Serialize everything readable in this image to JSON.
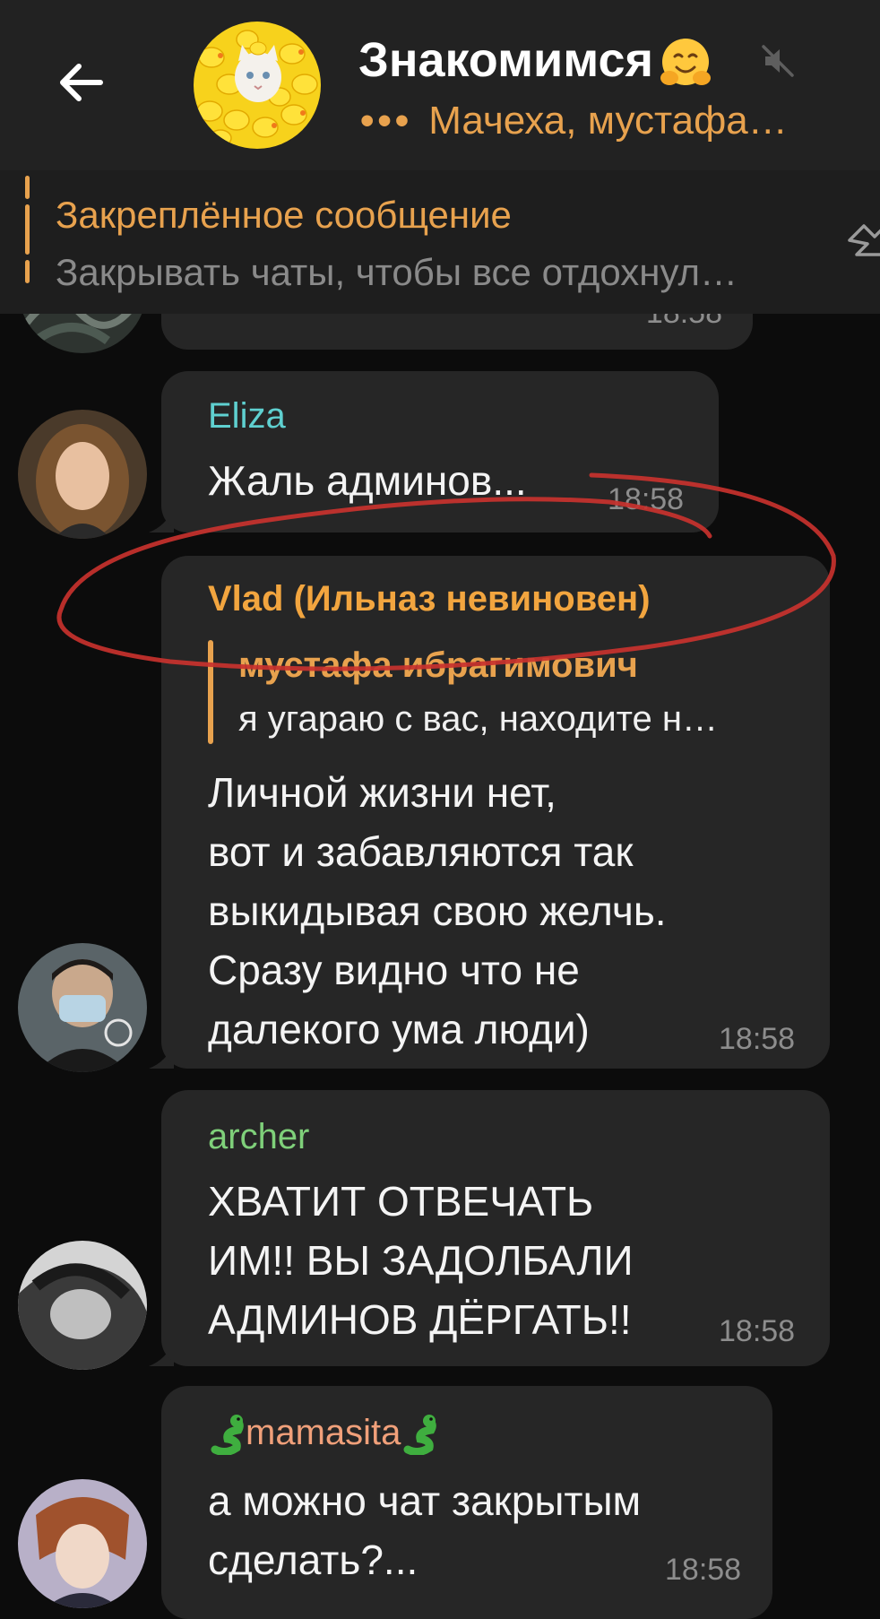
{
  "header": {
    "title": "Знакомимся",
    "status_dots": "•••",
    "status": "Мачеха, мустафа…",
    "colors": {
      "accent": "#e8a24e",
      "background": "#222222"
    }
  },
  "pinned": {
    "title": "Закреплённое сообщение",
    "text": "Закрывать чаты, чтобы все отдохнул…"
  },
  "messages": [
    {
      "time": "18:58"
    },
    {
      "sender": "Eliza",
      "sender_color": "#5fd0d0",
      "text": "Жаль админов...",
      "time": "18:58"
    },
    {
      "sender": "Vlad (Ильназ невиновен)",
      "sender_color": "#f2a53f",
      "reply": {
        "name": "мустафа ибрагимович",
        "text": "я угараю с вас, находите н…"
      },
      "lines": [
        "Личной жизни нет,",
        "вот и забавляются так",
        "выкидывая свою желчь.",
        "Сразу видно что не",
        "далекого ума люди)"
      ],
      "time": "18:58"
    },
    {
      "sender": "archer",
      "sender_color": "#7fd07a",
      "lines": [
        "ХВАТИТ ОТВЕЧАТЬ",
        "ИМ!! ВЫ ЗАДОЛБАЛИ",
        "АДМИНОВ ДЁРГАТЬ!!"
      ],
      "time": "18:58"
    },
    {
      "sender": "mamasita",
      "sender_color": "#f0a07a",
      "lines": [
        "а можно чат закрытым",
        "сделать?..."
      ],
      "time": "18:58"
    }
  ]
}
